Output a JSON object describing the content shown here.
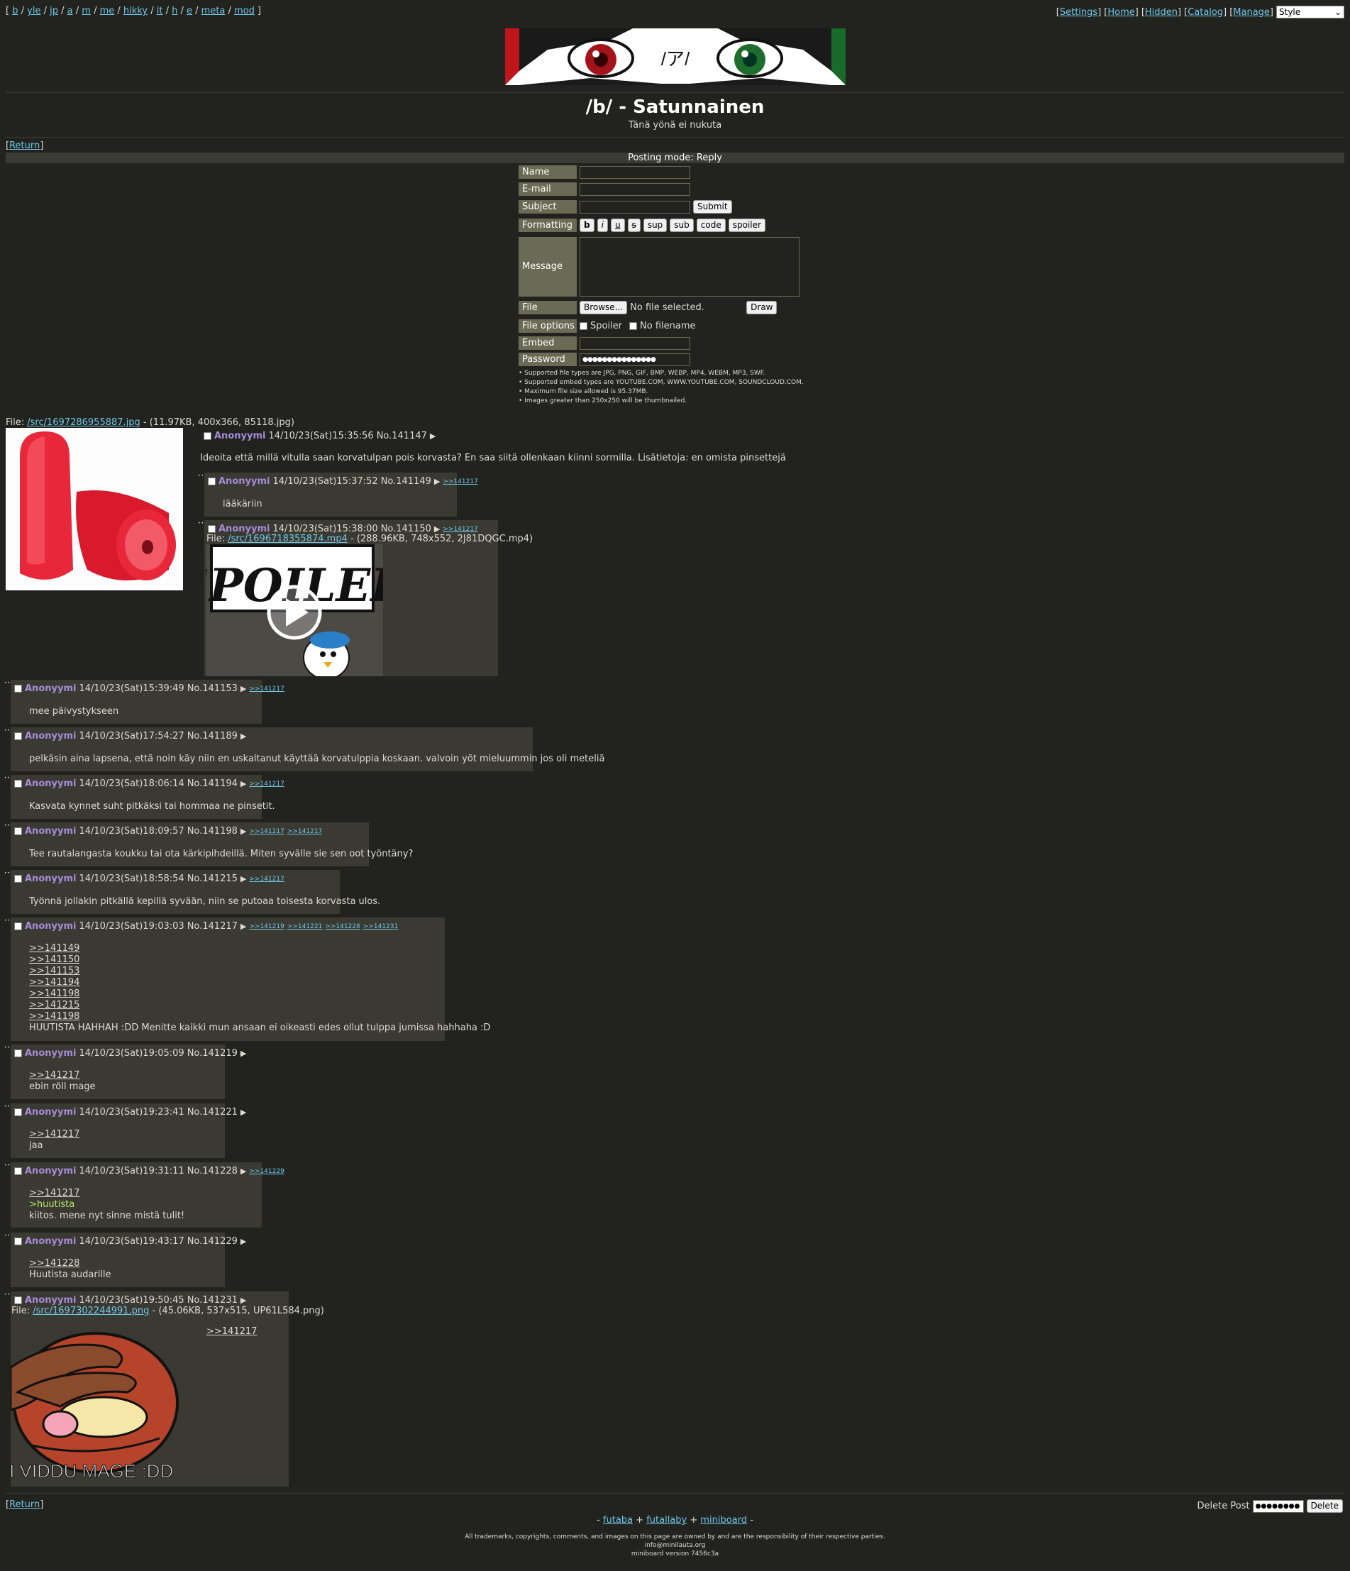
{
  "nav": {
    "boards": [
      "b",
      "yle",
      "jp",
      "a",
      "m",
      "me",
      "hikky",
      "it",
      "h",
      "e",
      "meta",
      "mod"
    ],
    "right_links": [
      "Settings",
      "Home",
      "Hidden",
      "Catalog",
      "Manage"
    ],
    "style_select": "Style"
  },
  "board": {
    "title": "/b/ - Satunnainen",
    "subtitle": "Tänä yönä ei nukuta",
    "banner_text": "/ア/"
  },
  "return_label": "Return",
  "postform": {
    "mode": "Posting mode: Reply",
    "labels": {
      "name": "Name",
      "email": "E-mail",
      "subject": "Subject",
      "formatting": "Formatting",
      "message": "Message",
      "file": "File",
      "file_options": "File options",
      "embed": "Embed",
      "password": "Password"
    },
    "submit": "Submit",
    "format_buttons": [
      "b",
      "i",
      "u",
      "s",
      "sup",
      "sub",
      "code",
      "spoiler"
    ],
    "browse": "Browse...",
    "no_file": "No file selected.",
    "draw": "Draw",
    "spoiler": "Spoiler",
    "no_filename": "No filename",
    "password_value": "●●●●●●●●●●●●●●●",
    "rules": [
      "• Supported file types are JPG, PNG, GIF, BMP, WEBP, MP4, WEBM, MP3, SWF.",
      "• Supported embed types are YOUTUBE.COM, WWW.YOUTUBE.COM, SOUNDCLOUD.COM.",
      "• Maximum file size allowed is 95.37MB.",
      "• Images greater than 250x250 will be thumbnailed."
    ]
  },
  "op": {
    "file_prefix": "File: ",
    "file_link": "/src/1697286955887.jpg",
    "file_info": " - (11.97KB, 400x366, 85118.jpg)",
    "name": "Anonyymi",
    "datetime": "14/10/23(Sat)15:35:56",
    "no": "No.141147",
    "message": "Ideoita että millä vitulla saan korvatulpan pois korvasta? En saa siitä ollenkaan kiinni sormilla. Lisätietoja: en omista pinsettejä"
  },
  "replies": [
    {
      "id": "141149",
      "name": "Anonyymi",
      "datetime": "14/10/23(Sat)15:37:52",
      "no": "No.141149",
      "backlinks": [
        ">>141217"
      ],
      "lines": [
        "lääkäriin"
      ]
    },
    {
      "id": "141150",
      "name": "Anonyymi",
      "datetime": "14/10/23(Sat)15:38:00",
      "no": "No.141150",
      "backlinks": [
        ">>141217"
      ],
      "file_prefix": "File: ",
      "file_link": "/src/1696718355874.mp4",
      "file_info": " - (288.96KB, 748x552, 2J81DQGC.mp4)",
      "thumb_text": "SPOILER"
    },
    {
      "id": "141153",
      "name": "Anonyymi",
      "datetime": "14/10/23(Sat)15:39:49",
      "no": "No.141153",
      "backlinks": [
        ">>141217"
      ],
      "lines": [
        "mee päivystykseen"
      ]
    },
    {
      "id": "141189",
      "name": "Anonyymi",
      "datetime": "14/10/23(Sat)17:54:27",
      "no": "No.141189",
      "backlinks": [],
      "lines": [
        "pelkäsin aina lapsena, että noin käy niin en uskaltanut käyttää korvatulppia koskaan. valvoin yöt mieluummin jos oli meteliä"
      ]
    },
    {
      "id": "141194",
      "name": "Anonyymi",
      "datetime": "14/10/23(Sat)18:06:14",
      "no": "No.141194",
      "backlinks": [
        ">>141217"
      ],
      "lines": [
        "Kasvata kynnet suht pitkäksi tai hommaa ne pinsetit."
      ]
    },
    {
      "id": "141198",
      "name": "Anonyymi",
      "datetime": "14/10/23(Sat)18:09:57",
      "no": "No.141198",
      "backlinks": [
        ">>141217",
        ">>141217"
      ],
      "lines": [
        "Tee rautalangasta koukku tai ota kärkipihdeillä. Miten syvälle sie sen oot työntäny?"
      ]
    },
    {
      "id": "141215",
      "name": "Anonyymi",
      "datetime": "14/10/23(Sat)18:58:54",
      "no": "No.141215",
      "backlinks": [
        ">>141217"
      ],
      "lines": [
        "Työnnä jollakin pitkällä kepillä syvään, niin se putoaa toisesta korvasta ulos."
      ]
    },
    {
      "id": "141217",
      "name": "Anonyymi",
      "datetime": "14/10/23(Sat)19:03:03",
      "no": "No.141217",
      "backlinks": [
        ">>141219",
        ">>141221",
        ">>141228",
        ">>141231"
      ],
      "quotes": [
        ">>141149",
        ">>141150",
        ">>141153",
        ">>141194",
        ">>141198",
        ">>141215",
        ">>141198"
      ],
      "lines": [
        "HUUTISTA HAHHAH :DD Menitte kaikki mun ansaan ei oikeasti edes ollut tulppa jumissa hahhaha :D"
      ]
    },
    {
      "id": "141219",
      "name": "Anonyymi",
      "datetime": "14/10/23(Sat)19:05:09",
      "no": "No.141219",
      "backlinks": [],
      "quotes": [
        ">>141217"
      ],
      "lines": [
        "ebin röll mage"
      ]
    },
    {
      "id": "141221",
      "name": "Anonyymi",
      "datetime": "14/10/23(Sat)19:23:41",
      "no": "No.141221",
      "backlinks": [],
      "quotes": [
        ">>141217"
      ],
      "lines": [
        "jaa"
      ]
    },
    {
      "id": "141228",
      "name": "Anonyymi",
      "datetime": "14/10/23(Sat)19:31:11",
      "no": "No.141228",
      "backlinks": [
        ">>141229"
      ],
      "quotes": [
        ">>141217"
      ],
      "greentext": ">huutista",
      "lines": [
        "kiitos. mene nyt sinne mistä tulit!"
      ]
    },
    {
      "id": "141229",
      "name": "Anonyymi",
      "datetime": "14/10/23(Sat)19:43:17",
      "no": "No.141229",
      "backlinks": [],
      "quotes": [
        ">>141228"
      ],
      "lines": [
        "Huutista audarille"
      ]
    },
    {
      "id": "141231",
      "name": "Anonyymi",
      "datetime": "14/10/23(Sat)19:50:45",
      "no": "No.141231",
      "backlinks": [],
      "file_prefix": "File: ",
      "file_link": "/src/1697302244991.png",
      "file_info": " - (45.06KB, 537x515, UP61L584.png)",
      "quotes": [
        ">>141217"
      ],
      "image_caption": "EI VIDDU MAGE :DD"
    }
  ],
  "footer": {
    "delete_label": "Delete Post",
    "delete_password": "●●●●●●●●",
    "delete_button": "Delete",
    "credits": [
      "futaba",
      "futallaby",
      "miniboard"
    ],
    "legal": "All trademarks, copyrights, comments, and images on this page are owned by and are the responsibility of their respective parties.",
    "email": "info@minilauta.org",
    "version": "miniboard version 7456c3a"
  },
  "colors": {
    "background": "#22231f",
    "post": "#3a3a32",
    "link": "#6fc7e7",
    "name": "#a78bd8",
    "label": "#6b6a54",
    "greentext": "#b7ea6c"
  }
}
